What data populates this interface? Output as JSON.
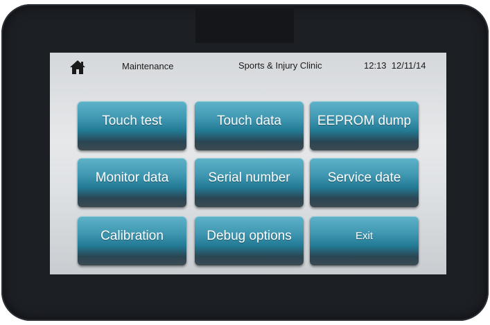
{
  "header": {
    "home_icon": "home-icon",
    "section_title": "Maintenance",
    "clinic_name": "Sports & Injury Clinic",
    "time": "12:13",
    "date": "12/11/14"
  },
  "buttons": [
    {
      "label": "Touch test"
    },
    {
      "label": "Touch data"
    },
    {
      "label": "EEPROM dump"
    },
    {
      "label": "Monitor data"
    },
    {
      "label": "Serial number"
    },
    {
      "label": "Service date"
    },
    {
      "label": "Calibration"
    },
    {
      "label": "Debug options"
    },
    {
      "label": "Exit"
    }
  ],
  "colors": {
    "button_top": "#5fb3c9",
    "button_bottom": "#2a4653",
    "bezel": "#1c1f24",
    "screen_bg": "#dfe2e5"
  }
}
